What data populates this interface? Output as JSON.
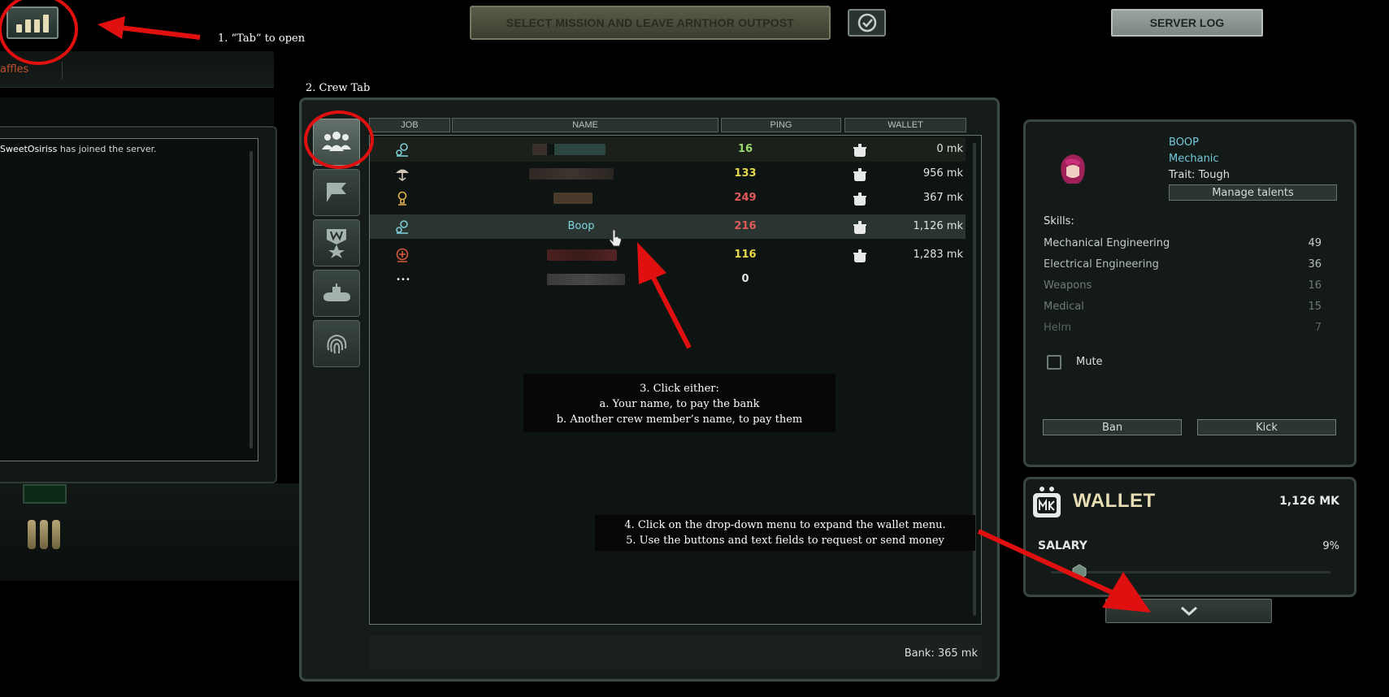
{
  "top_bar": {
    "mission_button": "SELECT MISSION AND LEAVE ARNTHOR OUTPOST",
    "server_log_button": "SERVER LOG"
  },
  "annotations": {
    "step1": "1. “Tab” to open",
    "step2": "2. Crew Tab",
    "step3_line1": "3. Click either:",
    "step3_line2": "a. Your name, to pay the bank",
    "step3_line3": "b. Another crew member’s name, to pay them",
    "step4_line1": "4. Click on the drop-down menu to expand the wallet menu.",
    "step5_line2": "5. Use the buttons and text fields to request or send money",
    "arrow_color": "#e01010"
  },
  "left_panel": {
    "tab_label": "affles",
    "chat_user": "SweetOsiriss",
    "chat_message": " has joined the server."
  },
  "crew_tabs": [
    "crew-icon",
    "flag-icon",
    "medal-icon",
    "submarine-icon",
    "fingerprint-icon"
  ],
  "crew_list": {
    "headers": {
      "job": "JOB",
      "name": "NAME",
      "ping": "PING",
      "wallet": "WALLET"
    },
    "rows": [
      {
        "job_icon": "mechanic-icon",
        "name": "",
        "ping": "16",
        "ping_color": "#9ad86a",
        "wallet": "0 mk"
      },
      {
        "job_icon": "security-icon",
        "name": "",
        "ping": "133",
        "ping_color": "#e8d84a",
        "wallet": "956 mk"
      },
      {
        "job_icon": "engineer-icon",
        "name": "",
        "ping": "249",
        "ping_color": "#e05a5a",
        "wallet": "367 mk"
      },
      {
        "job_icon": "mechanic-icon",
        "name": "Boop",
        "ping": "216",
        "ping_color": "#e05a5a",
        "wallet": "1,126 mk"
      },
      {
        "job_icon": "medic-icon",
        "name": "",
        "ping": "116",
        "ping_color": "#e8d84a",
        "wallet": "1,283 mk"
      },
      {
        "job_icon": "ellipsis-icon",
        "job_text": "•••",
        "name": "",
        "ping": "0",
        "ping_color": "#dde4e1",
        "wallet": ""
      }
    ],
    "bank": "Bank: 365 mk"
  },
  "character": {
    "name": "BOOP",
    "job": "Mechanic",
    "trait": "Trait: Tough",
    "manage_talents": "Manage talents",
    "skills_title": "Skills:",
    "skills": [
      {
        "name": "Mechanical Engineering",
        "value": "49",
        "color": "#c7cfcb"
      },
      {
        "name": "Electrical Engineering",
        "value": "36",
        "color": "#b5bebA"
      },
      {
        "name": "Weapons",
        "value": "16",
        "color": "#6f7a75"
      },
      {
        "name": "Medical",
        "value": "15",
        "color": "#6f7a75"
      },
      {
        "name": "Helm",
        "value": "7",
        "color": "#59635f"
      }
    ],
    "mute": "Mute",
    "ban": "Ban",
    "kick": "Kick"
  },
  "wallet": {
    "title": "WALLET",
    "amount": "1,126 MK",
    "salary_label": "SALARY",
    "salary_pct": "9%",
    "salary_fraction": 0.09
  }
}
